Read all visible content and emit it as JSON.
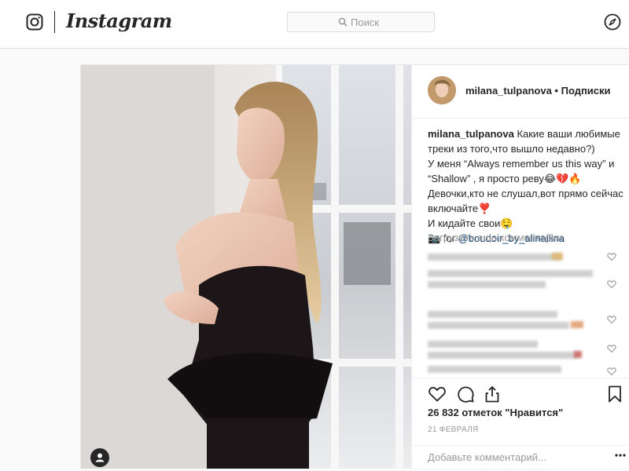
{
  "header": {
    "brand": "Instagram",
    "search_placeholder": "Поиск",
    "icons": [
      "instagram-logo-icon",
      "search-icon",
      "compass-icon"
    ]
  },
  "post": {
    "username": "milana_tulpanova",
    "header_separator": " • ",
    "follow_status": "Подписки",
    "caption": {
      "user": "milana_tulpanova",
      "lines": [
        "Какие ваши любимые",
        "треки из того,что вышло недавно?)",
        "У меня “Always remember us this way” и",
        "“Shallow” , я просто реву😂💔🔥",
        "Девочки,кто не слушал,вот прямо сейчас",
        "включайте❣️",
        "И кидайте свои🤤"
      ],
      "credit_prefix": "📷 for ",
      "credit_link": "@boudoir_by_alinailina"
    },
    "load_more": "Загрузить еще комментарии",
    "likes": "26 832 отметок \"Нравится\"",
    "date": "21 ФЕВРАЛЯ",
    "comment_placeholder": "Добавьте комментарий...",
    "action_icons": [
      "heart-icon",
      "comment-icon",
      "share-icon",
      "bookmark-icon"
    ]
  },
  "colors": {
    "link": "#003569",
    "muted": "#999999",
    "text": "#262626",
    "border": "#dbdbdb"
  }
}
